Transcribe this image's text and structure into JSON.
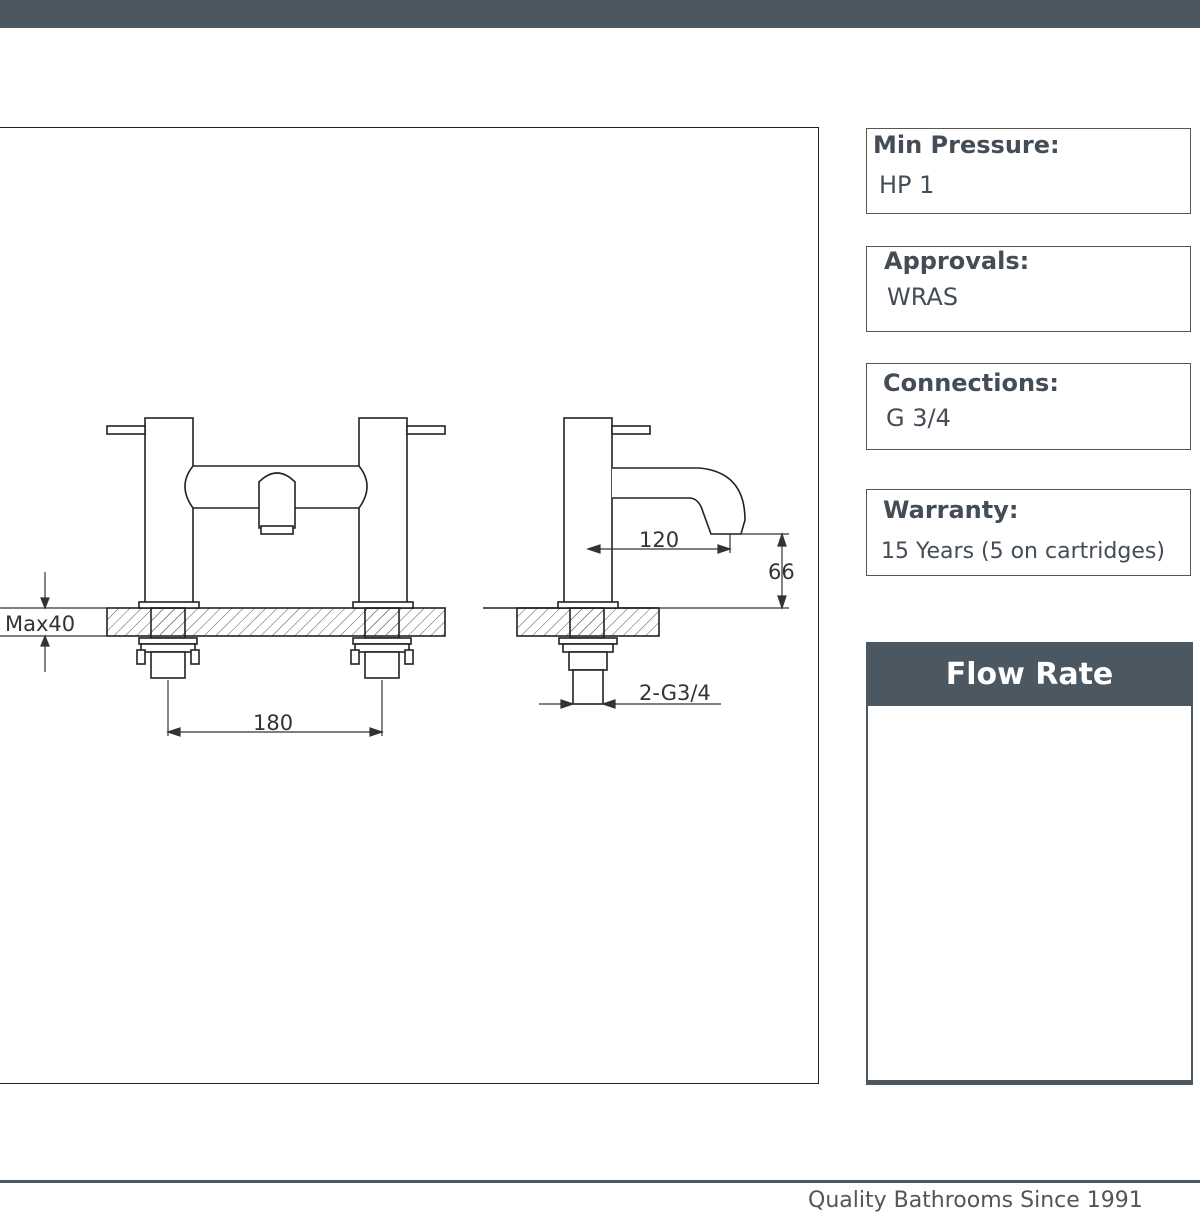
{
  "specs": [
    {
      "label": "Min Pressure:",
      "value": "HP 1"
    },
    {
      "label": "Approvals:",
      "value": "WRAS"
    },
    {
      "label": "Connections:",
      "value": "G 3/4"
    },
    {
      "label": "Warranty:",
      "value": "15 Years (5 on cartridges)"
    }
  ],
  "flow_rate": {
    "title": "Flow Rate"
  },
  "drawing": {
    "dim_max_deck": "Max40",
    "dim_centres": "180",
    "dim_spout_reach": "120",
    "dim_spout_height": "66",
    "dim_connection": "2-G3/4"
  },
  "footer": {
    "tagline": "Quality Bathrooms Since 1991"
  },
  "colors": {
    "header": "#4b5761",
    "text": "#444c55"
  }
}
